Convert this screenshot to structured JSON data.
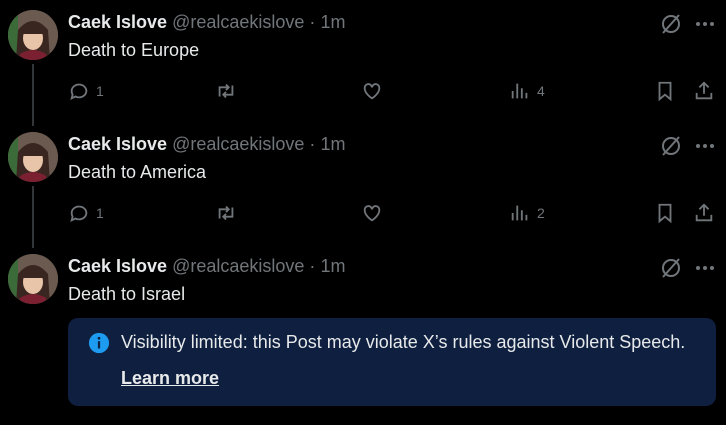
{
  "tweets": [
    {
      "author_name": "Caek Islove",
      "handle": "@realcaekislove",
      "separator": "·",
      "time": "1m",
      "text": "Death to Europe",
      "replies": "1",
      "views": "4"
    },
    {
      "author_name": "Caek Islove",
      "handle": "@realcaekislove",
      "separator": "·",
      "time": "1m",
      "text": "Death to America",
      "replies": "1",
      "views": "2"
    },
    {
      "author_name": "Caek Islove",
      "handle": "@realcaekislove",
      "separator": "·",
      "time": "1m",
      "text": "Death to Israel"
    }
  ],
  "notice": {
    "message": "Visibility limited: this Post may violate X’s rules against Violent Speech.",
    "link_label": "Learn more"
  },
  "icons": {
    "more": "more-icon",
    "grok": "grok-icon",
    "reply": "reply-icon",
    "repost": "repost-icon",
    "like": "like-icon",
    "views": "views-icon",
    "bookmark": "bookmark-icon",
    "share": "share-icon",
    "info": "info-icon"
  },
  "colors": {
    "background": "#000000",
    "text": "#e7e9ea",
    "muted": "#71767b",
    "notice_bg": "#0e1f3f",
    "info_accent": "#1d9bf0"
  }
}
